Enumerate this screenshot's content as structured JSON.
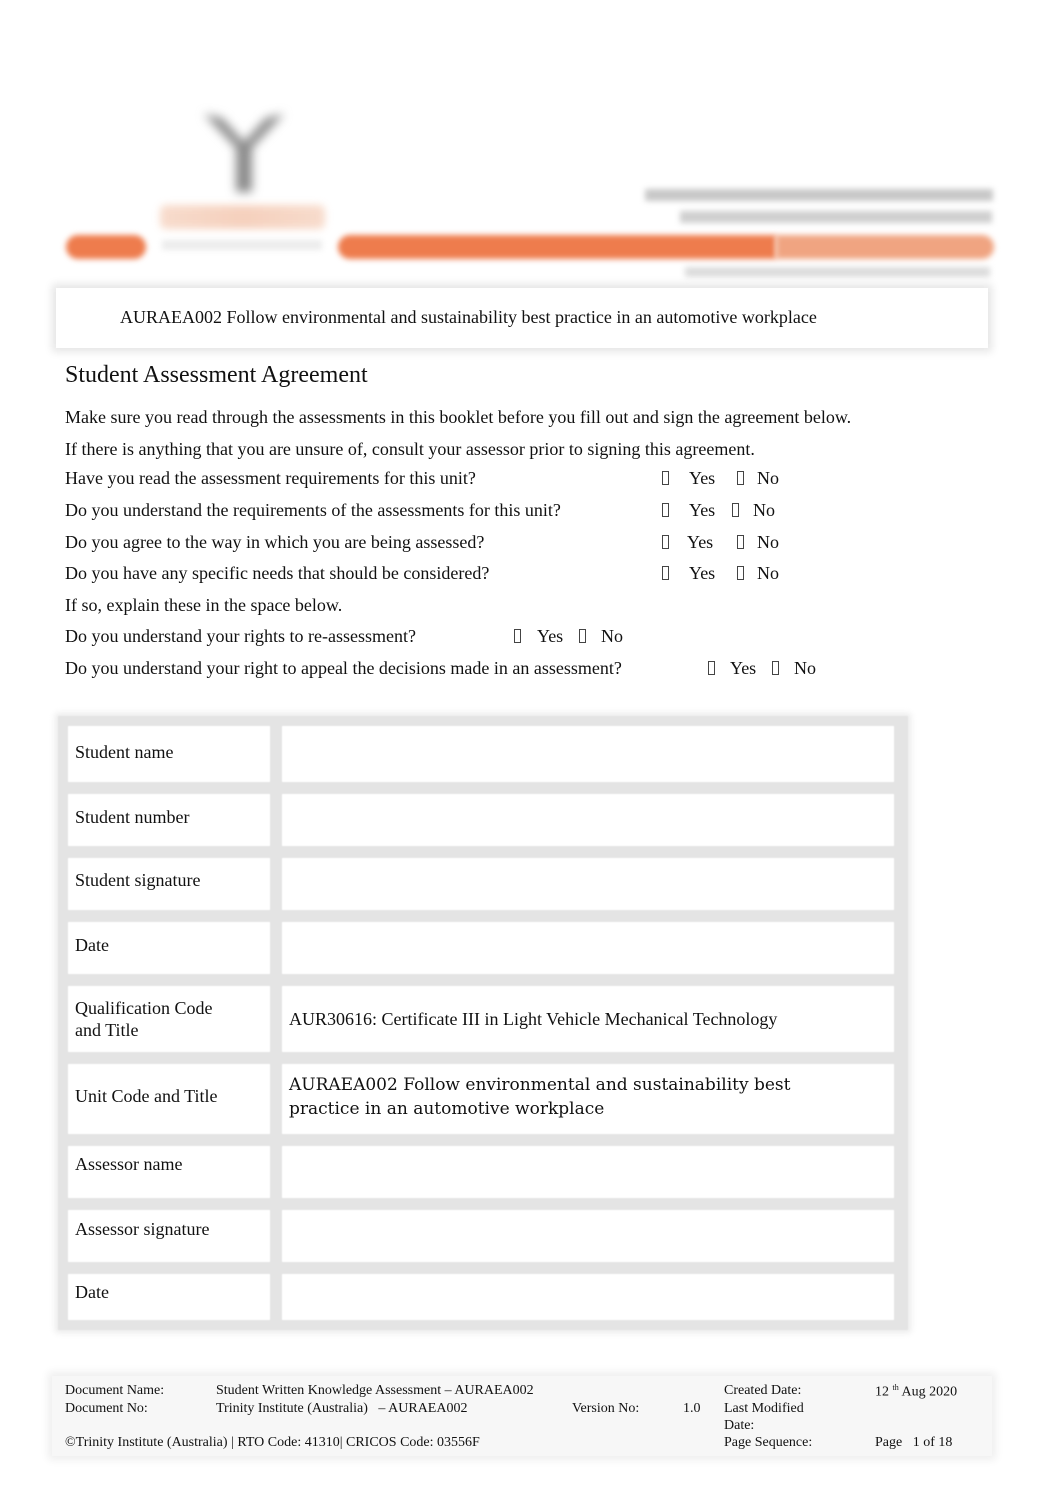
{
  "header": {
    "logo": "trinity-logo",
    "unit_title": "AURAEA002 Follow environmental and sustainability best practice in an automotive workplace",
    "accent_color": "#ee7c4d"
  },
  "main": {
    "heading": "Student Assessment Agreement",
    "intro": [
      "Make sure you read through the assessments in this booklet before you fill out and sign the agreement below.",
      "If there is anything that you are unsure of, consult your assessor prior to signing this agreement."
    ],
    "questions": [
      {
        "text": "Have you read the assessment requirements for this unit?",
        "yes": "Yes",
        "no": "No"
      },
      {
        "text": "Do you understand the requirements of the assessments for this unit?",
        "yes": "Yes",
        "no": "No"
      },
      {
        "text": "Do you agree to the way in which you are being assessed?",
        "yes": "Yes",
        "no": "No"
      },
      {
        "text": "Do you have any specific needs that should be considered?",
        "yes": "Yes",
        "no": "No"
      },
      {
        "text": "If so, explain these in the space below."
      },
      {
        "text": "Do you understand your rights to re-assessment?",
        "yes": "Yes",
        "no": "No"
      },
      {
        "text": "Do you understand your right to appeal the decisions made in an assessment?",
        "yes": "Yes",
        "no": "No"
      }
    ]
  },
  "table": {
    "rows": [
      {
        "label": "Student name",
        "value": ""
      },
      {
        "label": "Student number",
        "value": ""
      },
      {
        "label": "Student signature",
        "value": ""
      },
      {
        "label": "Date",
        "value": ""
      },
      {
        "label_line1": "Qualification Code",
        "label_line2": "and Title",
        "value": "AUR30616: Certificate III in Light Vehicle Mechanical Technology"
      },
      {
        "label": "Unit Code and Title",
        "value_line1": "AURAEA002 Follow environmental and sustainability best",
        "value_line2": "practice in an automotive workplace"
      },
      {
        "label": "Assessor name",
        "value": ""
      },
      {
        "label": "Assessor signature",
        "value": ""
      },
      {
        "label": "Date",
        "value": ""
      }
    ]
  },
  "footer": {
    "doc_name_label": "Document Name:",
    "doc_name": "Student Written Knowledge Assessment – AURAEA002",
    "doc_no_label": "Document No:",
    "doc_no": "Trinity Institute (Australia)   – AURAEA002",
    "version_label": "Version No:",
    "version": "1.0",
    "created_label": "Created Date:",
    "created_day": "12",
    "created_suffix": "th",
    "created_rest": " Aug 2020",
    "modified_label_line1": "Last Modified",
    "modified_label_line2": "Date:",
    "copyright": "©Trinity Institute (Australia) | RTO Code: 41310| CRICOS Code: 03556F",
    "page_seq_label": "Page Sequence:",
    "page_seq": "Page   1 of 18"
  }
}
